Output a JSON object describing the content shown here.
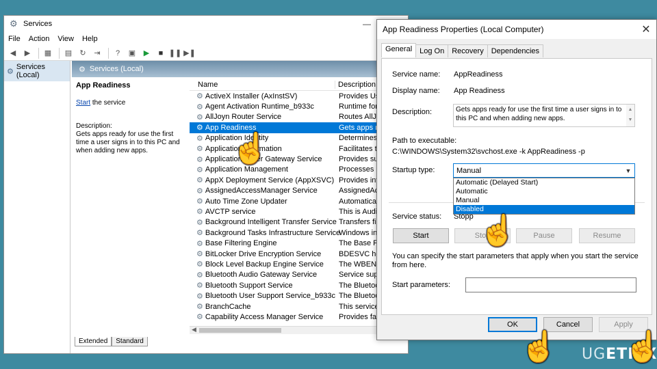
{
  "services_window": {
    "title": "Services",
    "controls": [
      "—",
      "☐"
    ],
    "menu": [
      "File",
      "Action",
      "View",
      "Help"
    ],
    "tree_item": "Services (Local)",
    "pane_header": "Services (Local)",
    "detail": {
      "title": "App Readiness",
      "start_link": "Start",
      "start_suffix": " the service",
      "desc_label": "Description:",
      "desc_text": "Gets apps ready for use the first time a user signs in to this PC and when adding new apps."
    },
    "columns": {
      "name": "Name",
      "description": "Description"
    },
    "rows": [
      {
        "name": "ActiveX Installer (AxInstSV)",
        "desc": "Provides Use"
      },
      {
        "name": "Agent Activation Runtime_b933c",
        "desc": "Runtime for"
      },
      {
        "name": "AllJoyn Router Service",
        "desc": "Routes AllJoy"
      },
      {
        "name": "App Readiness",
        "desc": "Gets apps rea"
      },
      {
        "name": "Application Identity",
        "desc": "Determines a"
      },
      {
        "name": "Application Information",
        "desc": "Facilitates th"
      },
      {
        "name": "Application Layer Gateway Service",
        "desc": "Provides sup"
      },
      {
        "name": "Application Management",
        "desc": "Processes ins"
      },
      {
        "name": "AppX Deployment Service (AppXSVC)",
        "desc": "Provides infr"
      },
      {
        "name": "AssignedAccessManager Service",
        "desc": "AssignedAcc"
      },
      {
        "name": "Auto Time Zone Updater",
        "desc": "Automaticall"
      },
      {
        "name": "AVCTP service",
        "desc": "This is Audio"
      },
      {
        "name": "Background Intelligent Transfer Service",
        "desc": "Transfers file"
      },
      {
        "name": "Background Tasks Infrastructure Service",
        "desc": "Windows inf"
      },
      {
        "name": "Base Filtering Engine",
        "desc": "The Base Filt"
      },
      {
        "name": "BitLocker Drive Encryption Service",
        "desc": "BDESVC host"
      },
      {
        "name": "Block Level Backup Engine Service",
        "desc": "The WBENGI"
      },
      {
        "name": "Bluetooth Audio Gateway Service",
        "desc": "Service supp"
      },
      {
        "name": "Bluetooth Support Service",
        "desc": "The Bluetoot"
      },
      {
        "name": "Bluetooth User Support Service_b933c",
        "desc": "The Bluetoot"
      },
      {
        "name": "BranchCache",
        "desc": "This service c"
      },
      {
        "name": "Capability Access Manager Service",
        "desc": "Provides faci"
      }
    ],
    "tabs": [
      "Extended",
      "Standard"
    ]
  },
  "dialog": {
    "title": "App Readiness Properties (Local Computer)",
    "close": "✕",
    "tabs": [
      "General",
      "Log On",
      "Recovery",
      "Dependencies"
    ],
    "service_name_label": "Service name:",
    "service_name": "AppReadiness",
    "display_name_label": "Display name:",
    "display_name": "App Readiness",
    "description_label": "Description:",
    "description": "Gets apps ready for use the first time a user signs in to this PC and when adding new apps.",
    "path_label": "Path to executable:",
    "path": "C:\\WINDOWS\\System32\\svchost.exe -k AppReadiness -p",
    "startup_label": "Startup type:",
    "startup_value": "Manual",
    "startup_options": [
      "Automatic (Delayed Start)",
      "Automatic",
      "Manual",
      "Disabled"
    ],
    "status_label": "Service status:",
    "status_value": "Stopp",
    "buttons": {
      "start": "Start",
      "stop": "Stop",
      "pause": "Pause",
      "resume": "Resume"
    },
    "params_hint": "You can specify the start parameters that apply when you start the service from here.",
    "params_label": "Start parameters:",
    "ok": "OK",
    "cancel": "Cancel",
    "apply": "Apply"
  },
  "watermark": {
    "a": "UG",
    "b": "ETFIX"
  },
  "colors": {
    "desktop": "#3e8aa0",
    "selection": "#0078d7"
  }
}
